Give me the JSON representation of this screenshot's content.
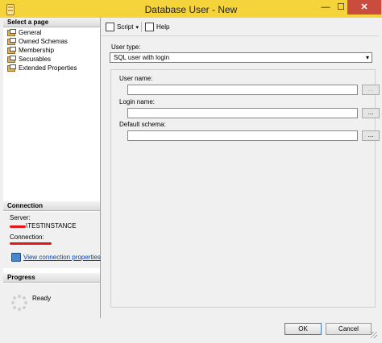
{
  "window": {
    "title": "Database User - New",
    "minimize": "—",
    "maximize": "☐",
    "close": "✕"
  },
  "sidebar": {
    "select_page_title": "Select a page",
    "pages": [
      {
        "label": "General"
      },
      {
        "label": "Owned Schemas"
      },
      {
        "label": "Membership"
      },
      {
        "label": "Securables"
      },
      {
        "label": "Extended Properties"
      }
    ],
    "connection": {
      "title": "Connection",
      "server_label": "Server:",
      "server_value": "\\TESTINSTANCE",
      "connection_label": "Connection:",
      "link": "View connection properties"
    },
    "progress": {
      "title": "Progress",
      "status": "Ready"
    }
  },
  "toolbar": {
    "script": "Script",
    "help": "Help"
  },
  "form": {
    "user_type_label": "User type:",
    "user_type_value": "SQL user with login",
    "user_name_label": "User name:",
    "login_name_label": "Login name:",
    "default_schema_label": "Default schema:",
    "browse_label": "..."
  },
  "footer": {
    "ok": "OK",
    "cancel": "Cancel"
  },
  "colors": {
    "titlebar": "#f5d33b",
    "close": "#c94c3f",
    "link": "#0645ad",
    "redaction": "#e21818"
  }
}
